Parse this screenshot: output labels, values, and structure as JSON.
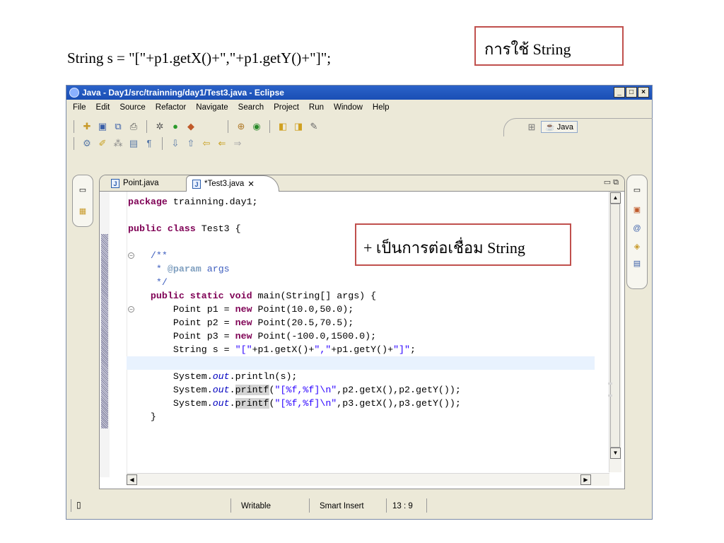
{
  "slide": {
    "code_text": "String s = \"[\"+p1.getX()+\",\"+p1.getY()+\"]\";",
    "callout_top": "การใช้ String",
    "callout_mid": "+ เป็นการต่อเชื่อม String"
  },
  "window": {
    "title": "Java - Day1/src/trainning/day1/Test3.java - Eclipse",
    "minimize": "_",
    "maximize": "□",
    "close": "×"
  },
  "menu": [
    "File",
    "Edit",
    "Source",
    "Refactor",
    "Navigate",
    "Search",
    "Project",
    "Run",
    "Window",
    "Help"
  ],
  "perspective": {
    "label": "Java"
  },
  "tabs": [
    {
      "label": "Point.java"
    },
    {
      "label": "*Test3.java",
      "close": "✕"
    }
  ],
  "code_lines": [
    "package trainning.day1;",
    "",
    "public class Test3 {",
    "",
    "    /**",
    "     * @param args",
    "     */",
    "    public static void main(String[] args) {",
    "        Point p1 = new Point(10.0,50.0);",
    "        Point p2 = new Point(20.5,70.5);",
    "        Point p3 = new Point(-100.0,1500.0);",
    "        String s = \"[\"+p1.getX()+\",\"+p1.getY()+\"]\";",
    "",
    "        System.out.println(s);",
    "        System.out.printf(\"[%f,%f]\\n\",p2.getX(),p2.getY());",
    "        System.out.printf(\"[%f,%f]\\n\",p3.getX(),p3.getY());",
    "    }"
  ],
  "status": {
    "writable": "Writable",
    "insert_mode": "Smart Insert",
    "position": "13 : 9"
  },
  "colors": {
    "keyword": "#7f0055",
    "comment": "#3f5fbf",
    "string": "#2a00ff",
    "callout_border": "#c0504d",
    "titlebar": "#2b62c9"
  }
}
